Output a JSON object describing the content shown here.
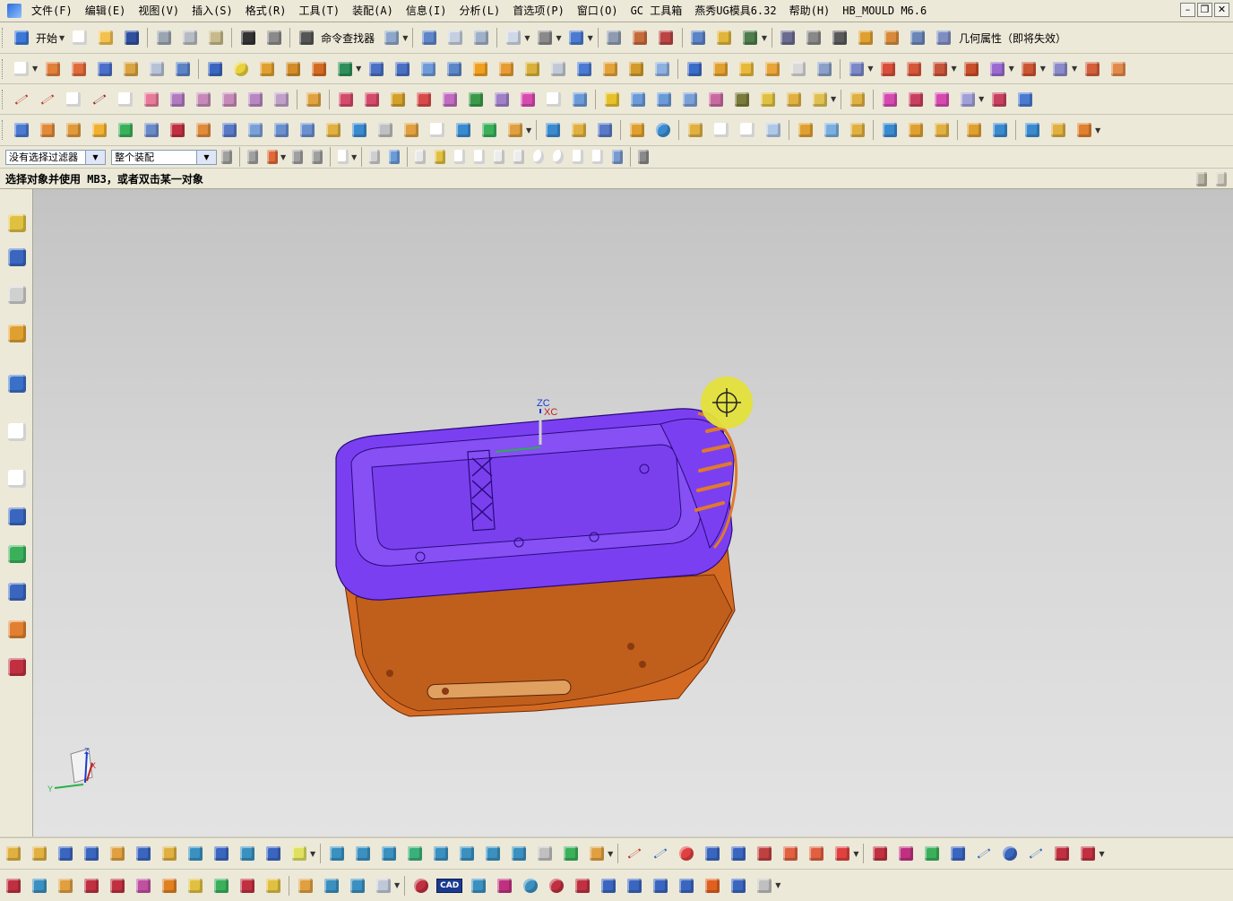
{
  "menu": {
    "items": [
      "文件(F)",
      "编辑(E)",
      "视图(V)",
      "插入(S)",
      "格式(R)",
      "工具(T)",
      "装配(A)",
      "信息(I)",
      "分析(L)",
      "首选项(P)",
      "窗口(O)",
      "GC 工具箱",
      "燕秀UG模具6.32",
      "帮助(H)",
      "HB_MOULD M6.6"
    ]
  },
  "window_buttons": {
    "minimize": "–",
    "restore": "❐",
    "close": "✕"
  },
  "toolbar1": {
    "start_label": "开始",
    "command_finder": "命令查找器",
    "geometry_property": "几何属性（即将失效）"
  },
  "filter": {
    "type_filter": "没有选择过滤器",
    "scope": "整个装配"
  },
  "status": {
    "prompt": "选择对象并使用 MB3，或者双击某一对象"
  },
  "viewport": {
    "wcs_z_label": "ZC",
    "wcs_x_label": "XC",
    "triad_z": "Z",
    "triad_y": "Y",
    "triad_x": "X"
  },
  "bottom_toolbar": {
    "cad_label": "CAD"
  },
  "colors": {
    "top_surface": "#7b3ff2",
    "side_surface": "#d46a22",
    "highlight_cursor": "#e3e03a"
  }
}
